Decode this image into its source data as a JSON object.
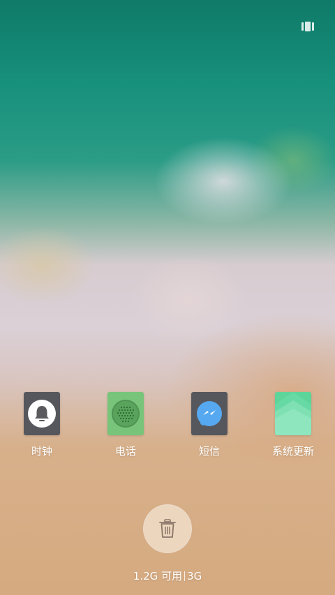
{
  "apps": [
    {
      "label": "时钟",
      "icon": "alarm-clock-icon"
    },
    {
      "label": "电话",
      "icon": "phone-icon"
    },
    {
      "label": "短信",
      "icon": "messenger-icon"
    },
    {
      "label": "系统更新",
      "icon": "system-update-icon"
    }
  ],
  "memory": {
    "available": "1.2G 可用",
    "total": "3G"
  },
  "clear_button": {
    "icon": "trash-icon"
  },
  "recents_toggle": {
    "icon": "recents-layout-icon"
  }
}
